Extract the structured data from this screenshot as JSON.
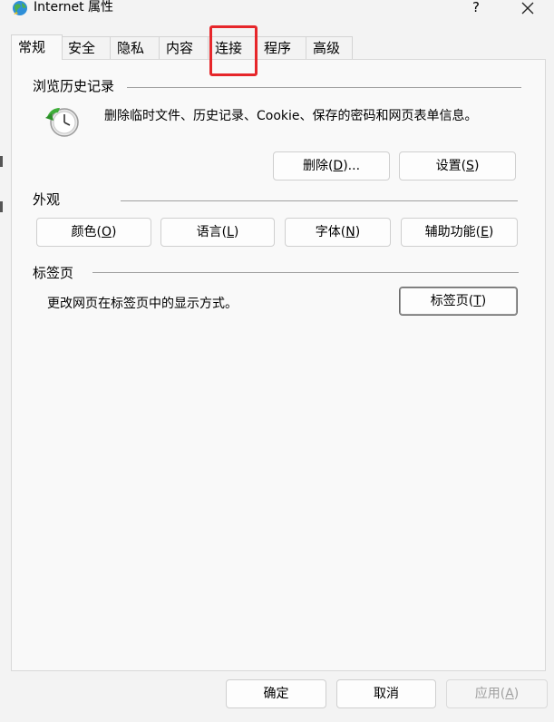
{
  "window": {
    "title": "Internet 属性",
    "help_label": "?",
    "close_icon": "close-icon",
    "app_icon": "globe-icon"
  },
  "tabs": [
    {
      "label": "常规",
      "selected": true
    },
    {
      "label": "安全",
      "selected": false
    },
    {
      "label": "隐私",
      "selected": false
    },
    {
      "label": "内容",
      "selected": false
    },
    {
      "label": "连接",
      "selected": false
    },
    {
      "label": "程序",
      "selected": false
    },
    {
      "label": "高级",
      "selected": false
    }
  ],
  "highlight_color": "#e6262a",
  "history": {
    "title": "浏览历史记录",
    "description": "删除临时文件、历史记录、Cookie、保存的密码和网页表单信息。",
    "delete_button": {
      "label": "删除",
      "key": "D",
      "suffix": "..."
    },
    "settings_button": {
      "label": "设置",
      "key": "S"
    }
  },
  "appearance": {
    "title": "外观",
    "colors_button": {
      "label": "颜色",
      "key": "O"
    },
    "languages_button": {
      "label": "语言",
      "key": "L"
    },
    "fonts_button": {
      "label": "字体",
      "key": "N"
    },
    "accessibility_button": {
      "label": "辅助功能",
      "key": "E"
    }
  },
  "tabs_group": {
    "title": "标签页",
    "description": "更改网页在标签页中的显示方式。",
    "tabs_button": {
      "label": "标签页",
      "key": "T"
    }
  },
  "footer": {
    "ok_label": "确定",
    "cancel_label": "取消",
    "apply_button": {
      "label": "应用",
      "key": "A",
      "disabled": true
    }
  }
}
